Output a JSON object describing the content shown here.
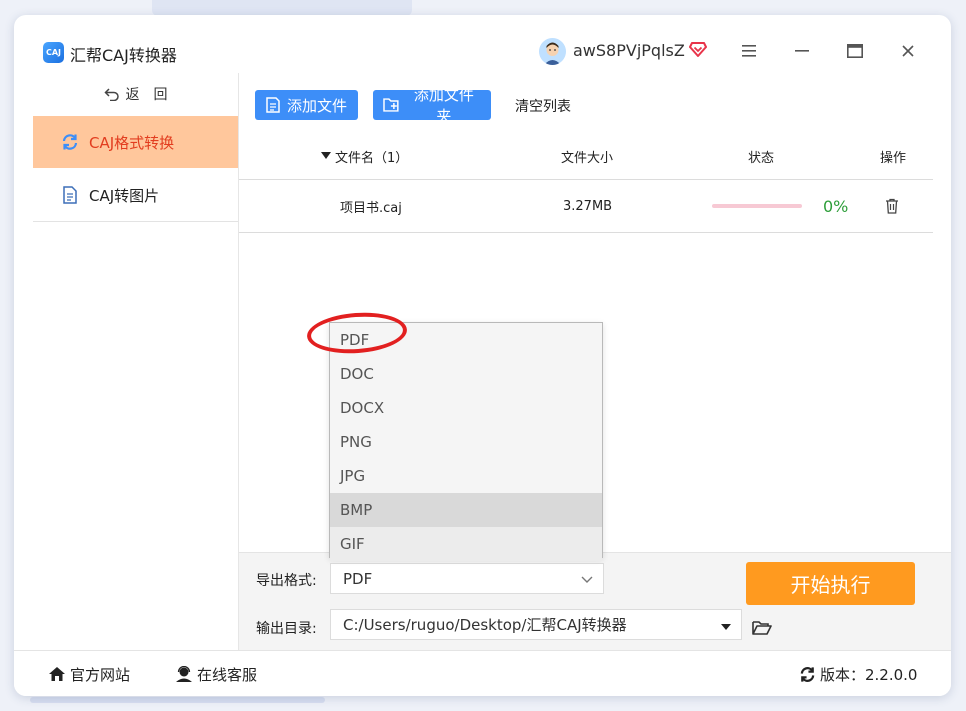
{
  "app": {
    "title": "汇帮CAJ转换器",
    "logo_text": "CAJ"
  },
  "user": {
    "name": "awS8PVjPqlsZ"
  },
  "colors": {
    "primary": "#3d8ef8",
    "accent": "#ff9a1f",
    "active_bg": "#ffc79c",
    "active_text": "#e23d1f",
    "success": "#2e9e3a"
  },
  "sidebar": {
    "back_label": "返　回",
    "items": [
      {
        "label": "CAJ格式转换",
        "icon": "refresh-icon",
        "active": true
      },
      {
        "label": "CAJ转图片",
        "icon": "document-icon",
        "active": false
      }
    ]
  },
  "toolbar": {
    "add_file": "添加文件",
    "add_folder": "添加文件夹",
    "clear_list": "清空列表"
  },
  "table": {
    "headers": {
      "name": "文件名（1）",
      "size": "文件大小",
      "status": "状态",
      "action": "操作"
    },
    "rows": [
      {
        "name": "项目书.caj",
        "size": "3.27MB",
        "progress": 0,
        "percent": "0%"
      }
    ]
  },
  "format": {
    "label": "导出格式:",
    "selected": "PDF",
    "options": [
      "PDF",
      "DOC",
      "DOCX",
      "PNG",
      "JPG",
      "BMP",
      "GIF"
    ],
    "hovered": "BMP"
  },
  "output": {
    "label": "输出目录:",
    "path": "C:/Users/ruguo/Desktop/汇帮CAJ转换器"
  },
  "start_button": "开始执行",
  "footer": {
    "website": "官方网站",
    "support": "在线客服",
    "version": "版本：2.2.0.0"
  }
}
